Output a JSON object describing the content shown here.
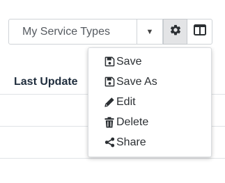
{
  "toolbar": {
    "view_select_value": "My Service Types",
    "caret_icon": "caret-down-icon",
    "settings_icon": "gear-icon",
    "columns_icon": "columns-icon"
  },
  "table": {
    "column_header": "Last Update"
  },
  "menu": {
    "items": [
      {
        "label": "Save",
        "icon": "save-icon"
      },
      {
        "label": "Save As",
        "icon": "save-icon"
      },
      {
        "label": "Edit",
        "icon": "pencil-icon"
      },
      {
        "label": "Delete",
        "icon": "trash-icon"
      },
      {
        "label": "Share",
        "icon": "share-icon"
      }
    ]
  },
  "colors": {
    "active_button_bg": "#e3e4e6",
    "text": "#2b2f33",
    "border": "#cfd3d7"
  }
}
